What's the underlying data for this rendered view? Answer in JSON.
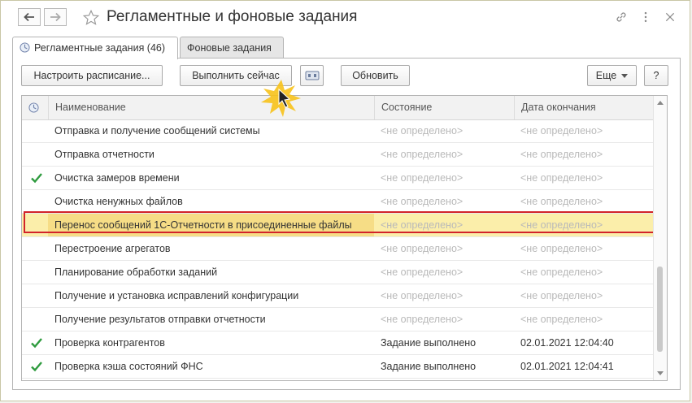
{
  "window": {
    "title": "Регламентные и фоновые задания",
    "back_icon": "arrow-left-icon",
    "forward_icon": "arrow-right-icon",
    "star_icon": "star-icon",
    "link_icon": "link-icon",
    "more_icon": "more-vertical-icon",
    "close_icon": "close-icon"
  },
  "tabs": [
    {
      "label": "Регламентные задания (46)",
      "active": true
    },
    {
      "label": "Фоновые задания",
      "active": false
    }
  ],
  "toolbar": {
    "schedule_label": "Настроить расписание...",
    "run_now_label": "Выполнить сейчас",
    "refresh_label": "Обновить",
    "more_label": "Еще",
    "help_label": "?"
  },
  "grid": {
    "columns": {
      "name": "Наименование",
      "state": "Состояние",
      "end_date": "Дата окончания"
    },
    "rows": [
      {
        "done": false,
        "name": "Отправка и получение сообщений системы",
        "state": "<не определено>",
        "end_date": "<не определено>"
      },
      {
        "done": false,
        "name": "Отправка отчетности",
        "state": "<не определено>",
        "end_date": "<не определено>"
      },
      {
        "done": true,
        "name": "Очистка замеров времени",
        "state": "<не определено>",
        "end_date": "<не определено>"
      },
      {
        "done": false,
        "name": "Очистка ненужных файлов",
        "state": "<не определено>",
        "end_date": "<не определено>"
      },
      {
        "done": false,
        "name": "Перенос сообщений 1С-Отчетности в присоединенные файлы",
        "state": "<не определено>",
        "end_date": "<не определено>",
        "selected": true
      },
      {
        "done": false,
        "name": "Перестроение агрегатов",
        "state": "<не определено>",
        "end_date": "<не определено>"
      },
      {
        "done": false,
        "name": "Планирование обработки заданий",
        "state": "<не определено>",
        "end_date": "<не определено>"
      },
      {
        "done": false,
        "name": "Получение и установка исправлений конфигурации",
        "state": "<не определено>",
        "end_date": "<не определено>"
      },
      {
        "done": false,
        "name": "Получение результатов отправки отчетности",
        "state": "<не определено>",
        "end_date": "<не определено>"
      },
      {
        "done": true,
        "name": "Проверка контрагентов",
        "state": "Задание выполнено",
        "end_date": "02.01.2021 12:04:40"
      },
      {
        "done": true,
        "name": "Проверка кэша состояний ФНС",
        "state": "Задание выполнено",
        "end_date": "02.01.2021 12:04:41"
      }
    ]
  },
  "colors": {
    "check": "#2e9b3e",
    "selected_row": "#fbeeaa",
    "selected_cell": "#f6dd86",
    "highlight_border": "#d2232a",
    "undefined_text": "#b9b9b9"
  }
}
